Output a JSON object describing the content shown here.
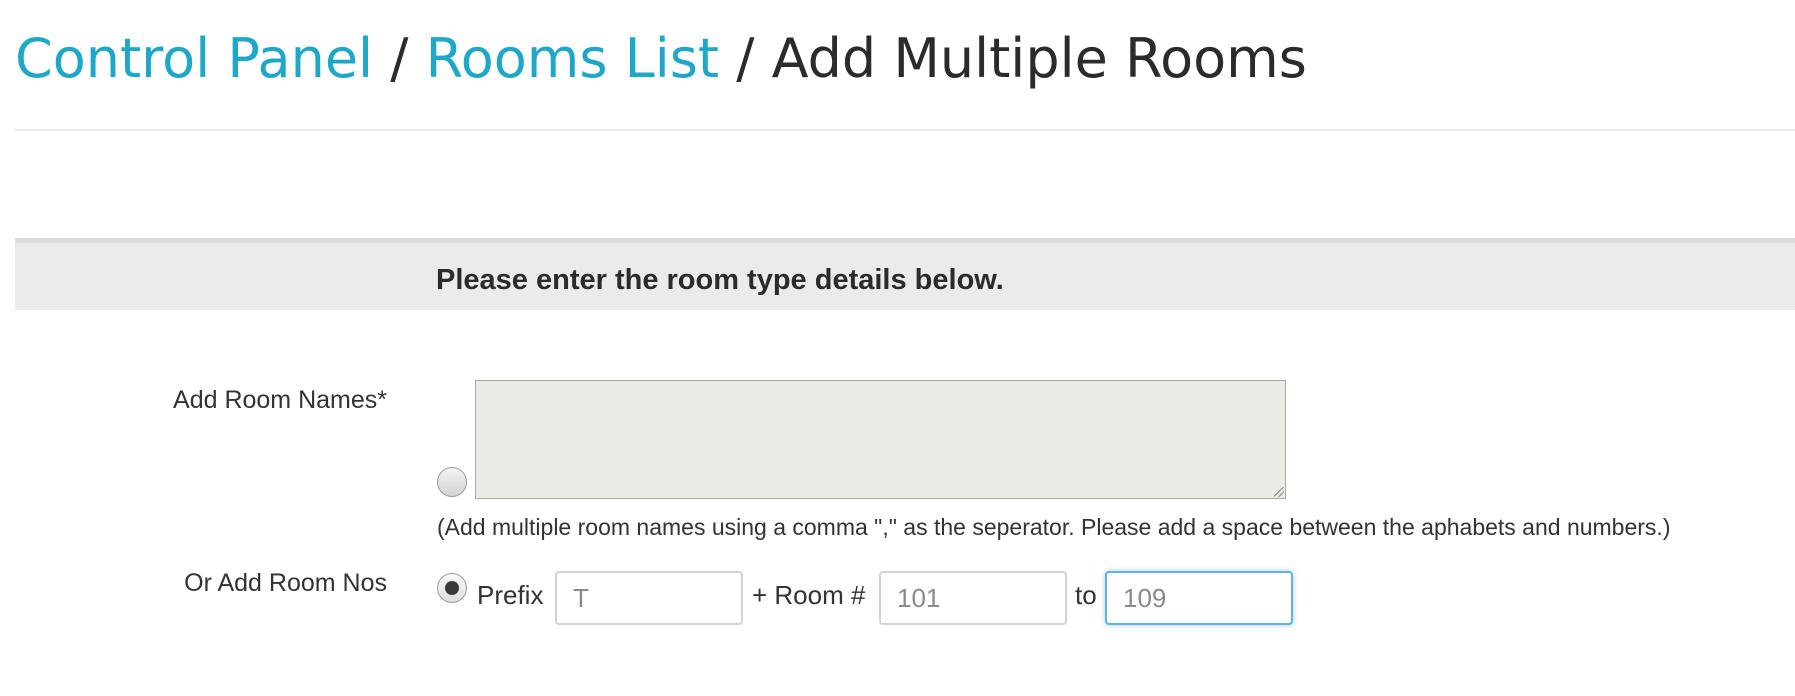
{
  "breadcrumb": {
    "items": [
      {
        "label": "Control Panel",
        "link": true
      },
      {
        "label": "Rooms List",
        "link": true
      },
      {
        "label": "Add Multiple Rooms",
        "link": false
      }
    ],
    "separator": "/"
  },
  "colors": {
    "link": "#1ea7c6",
    "text": "#2b2b2b",
    "section_bg": "#ebebeb",
    "textarea_bg": "#ebeae4",
    "focus_border": "#66afe9"
  },
  "section": {
    "title": "Please enter the room type details below."
  },
  "form": {
    "room_names": {
      "label": "Add Room Names*",
      "value": "",
      "selected": false,
      "help": "(Add multiple room names using a comma \",\" as the seperator. Please add a space between the aphabets and numbers.)"
    },
    "room_nos": {
      "label": "Or Add Room Nos",
      "selected": true,
      "prefix_label": "Prefix",
      "prefix_placeholder": "T",
      "room_label": "+ Room #",
      "from_placeholder": "101",
      "to_label": "to",
      "to_placeholder": "109"
    }
  }
}
